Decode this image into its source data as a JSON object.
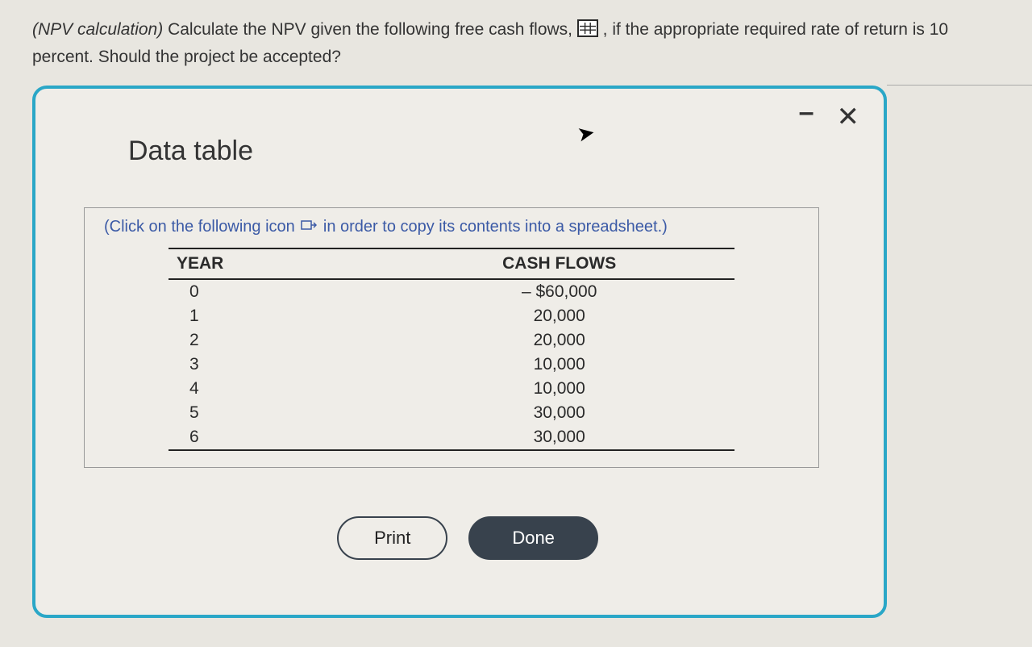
{
  "question": {
    "lead_italic": "(NPV calculation)",
    "body_before_icon": " Calculate the NPV given the following free cash flows, ",
    "body_after_icon": " , if the appropriate required rate of return is 10 percent. Should the project be accepted?"
  },
  "modal": {
    "title": "Data table",
    "controls": {
      "minimize": "–",
      "close": "✕"
    },
    "hint_before": "(Click on the following icon ",
    "hint_after": " in order to copy its contents into a spreadsheet.)",
    "table": {
      "headers": {
        "year": "YEAR",
        "cash": "CASH FLOWS"
      },
      "rows": [
        {
          "year": "0",
          "cash": "– $60,000"
        },
        {
          "year": "1",
          "cash": "20,000"
        },
        {
          "year": "2",
          "cash": "20,000"
        },
        {
          "year": "3",
          "cash": "10,000"
        },
        {
          "year": "4",
          "cash": "10,000"
        },
        {
          "year": "5",
          "cash": "30,000"
        },
        {
          "year": "6",
          "cash": "30,000"
        }
      ]
    },
    "buttons": {
      "print": "Print",
      "done": "Done"
    }
  },
  "chart_data": {
    "type": "table",
    "title": "NPV free cash flows",
    "required_rate_of_return": 0.1,
    "rows": [
      {
        "year": 0,
        "cash_flow": -60000
      },
      {
        "year": 1,
        "cash_flow": 20000
      },
      {
        "year": 2,
        "cash_flow": 20000
      },
      {
        "year": 3,
        "cash_flow": 10000
      },
      {
        "year": 4,
        "cash_flow": 10000
      },
      {
        "year": 5,
        "cash_flow": 30000
      },
      {
        "year": 6,
        "cash_flow": 30000
      }
    ]
  }
}
